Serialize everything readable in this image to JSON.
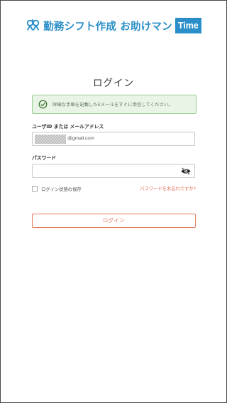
{
  "app": {
    "brand_name": "勤務シフト作成 お助けマン",
    "brand_badge": "Time",
    "accent_color": "#2a8fc8"
  },
  "page": {
    "title": "ログイン"
  },
  "alert": {
    "type": "success",
    "icon": "check-circle-icon",
    "message": "詳細な手順を記載したEメールをすぐに受信してください。",
    "color": "#9ccf92"
  },
  "form": {
    "user_label": "ユーザID または メールアドレス",
    "user_value_suffix": "@gmail.com",
    "password_label": "パスワード",
    "password_value": "",
    "password_toggle_icon": "eye-slash-icon",
    "remember_label": "ログイン状態の保存",
    "remember_checked": false,
    "forgot_link": "パスワードをお忘れですか?",
    "submit_label": "ログイン",
    "link_color": "#e06a55"
  }
}
